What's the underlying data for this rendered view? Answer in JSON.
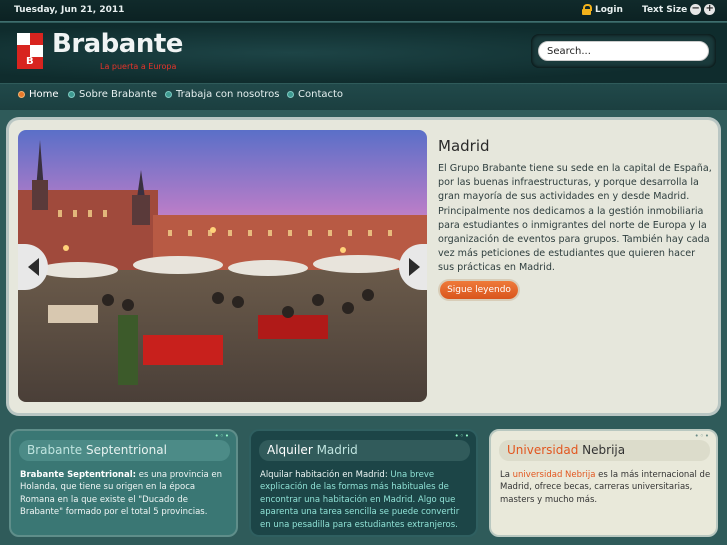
{
  "topbar": {
    "date": "Tuesday, Jun 21, 2011",
    "login": "Login",
    "text_size": "Text Size",
    "icons": [
      "lock-icon",
      "decrease-text-icon",
      "increase-text-icon"
    ]
  },
  "header": {
    "site_name": "Brabante",
    "tagline": "La puerta a Europa",
    "search_placeholder": "Search..."
  },
  "nav": {
    "items": [
      {
        "label": "Home",
        "active": true
      },
      {
        "label": "Sobre Brabante",
        "active": false
      },
      {
        "label": "Trabaja con nosotros",
        "active": false
      },
      {
        "label": "Contacto",
        "active": false
      }
    ]
  },
  "feature": {
    "title": "Madrid",
    "text": "El Grupo Brabante tiene su sede en la capital de España, por las buenas infraestructuras, y porque desarrolla la gran mayoría de sus actividades en y desde Madrid. Principalmente nos dedicamos a la gestión inmobiliaria para estudiantes o inmigrantes del norte de Europa y la organización de eventos para grupos. También hay cada vez más peticiones de estudiantes que quieren hacer sus prácticas en Madrid.",
    "button": "Sigue leyendo"
  },
  "boxes": [
    {
      "title_a": "Brabante",
      "title_b": "Septentrional",
      "lead": "Brabante Septentrional:",
      "text": "es una provincia en Holanda, que tiene su origen en la época Romana en la que existe el \"Ducado de Brabante\" formado por el total 5 provincias."
    },
    {
      "title_a": "Alquiler",
      "title_b": "Madrid",
      "lead": "Alquilar habitación en Madrid:",
      "text_hl": "Una breve",
      "text": "explicación de las formas más habituales de encontrar una habitación en Madrid. Algo que aparenta una tarea sencilla se puede convertir en una pesadilla para estudiantes extranjeros."
    },
    {
      "title_a": "Universidad",
      "title_b": "Nebrija",
      "lead": "La",
      "lead_hl": "universidad Nebrija",
      "text": "es la más internacional de Madrid, ofrece becas, carreras universitarias, masters y mucho más."
    }
  ],
  "colors": {
    "accent_orange": "#e2561f",
    "logo_red": "#e8342a",
    "teal_dark": "#1c4547",
    "teal_mid": "#3a7774"
  }
}
